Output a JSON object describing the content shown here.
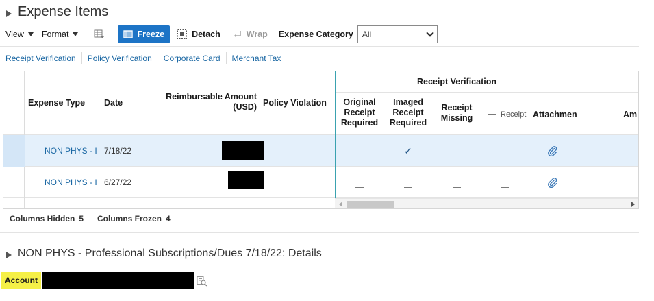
{
  "section_title": "Expense Items",
  "toolbar": {
    "view": "View",
    "format": "Format",
    "freeze": "Freeze",
    "detach": "Detach",
    "wrap": "Wrap",
    "expense_category_label": "Expense Category",
    "expense_category_value": "All"
  },
  "tabs": [
    "Receipt Verification",
    "Policy Verification",
    "Corporate Card",
    "Merchant Tax"
  ],
  "table": {
    "columns": {
      "expense_type": "Expense Type",
      "date": "Date",
      "reimbursable_amount": "Reimbursable Amount",
      "reimbursable_unit": "(USD)",
      "policy_violation": "Policy Violation",
      "group_receipt_verification": "Receipt Verification",
      "original_receipt_required_l1": "Original",
      "original_receipt_required_l2": "Receipt",
      "original_receipt_required_l3": "Required",
      "imaged_receipt_required_l1": "Imaged",
      "imaged_receipt_required_l2": "Receipt",
      "imaged_receipt_required_l3": "Required",
      "receipt_missing_l1": "Receipt",
      "receipt_missing_l2": "Missing",
      "receipt_truncated": "Receipt",
      "attachments": "Attachmen",
      "amount_truncated": "Am"
    },
    "rows": [
      {
        "expense_type": "NON PHYS - I",
        "date": "7/18/22",
        "imaged_receipt": "✓"
      },
      {
        "expense_type": "NON PHYS - I",
        "date": "6/27/22"
      }
    ]
  },
  "status": {
    "columns_hidden_label": "Columns Hidden",
    "columns_hidden_value": "5",
    "columns_frozen_label": "Columns Frozen",
    "columns_frozen_value": "4"
  },
  "details_title": "NON PHYS - Professional Subscriptions/Dues 7/18/22: Details",
  "account_label": "Account",
  "colors": {
    "accent": "#1d74c6",
    "link": "#1a67a3",
    "highlight": "#f5f047",
    "selected_row": "#e4f0fb"
  }
}
